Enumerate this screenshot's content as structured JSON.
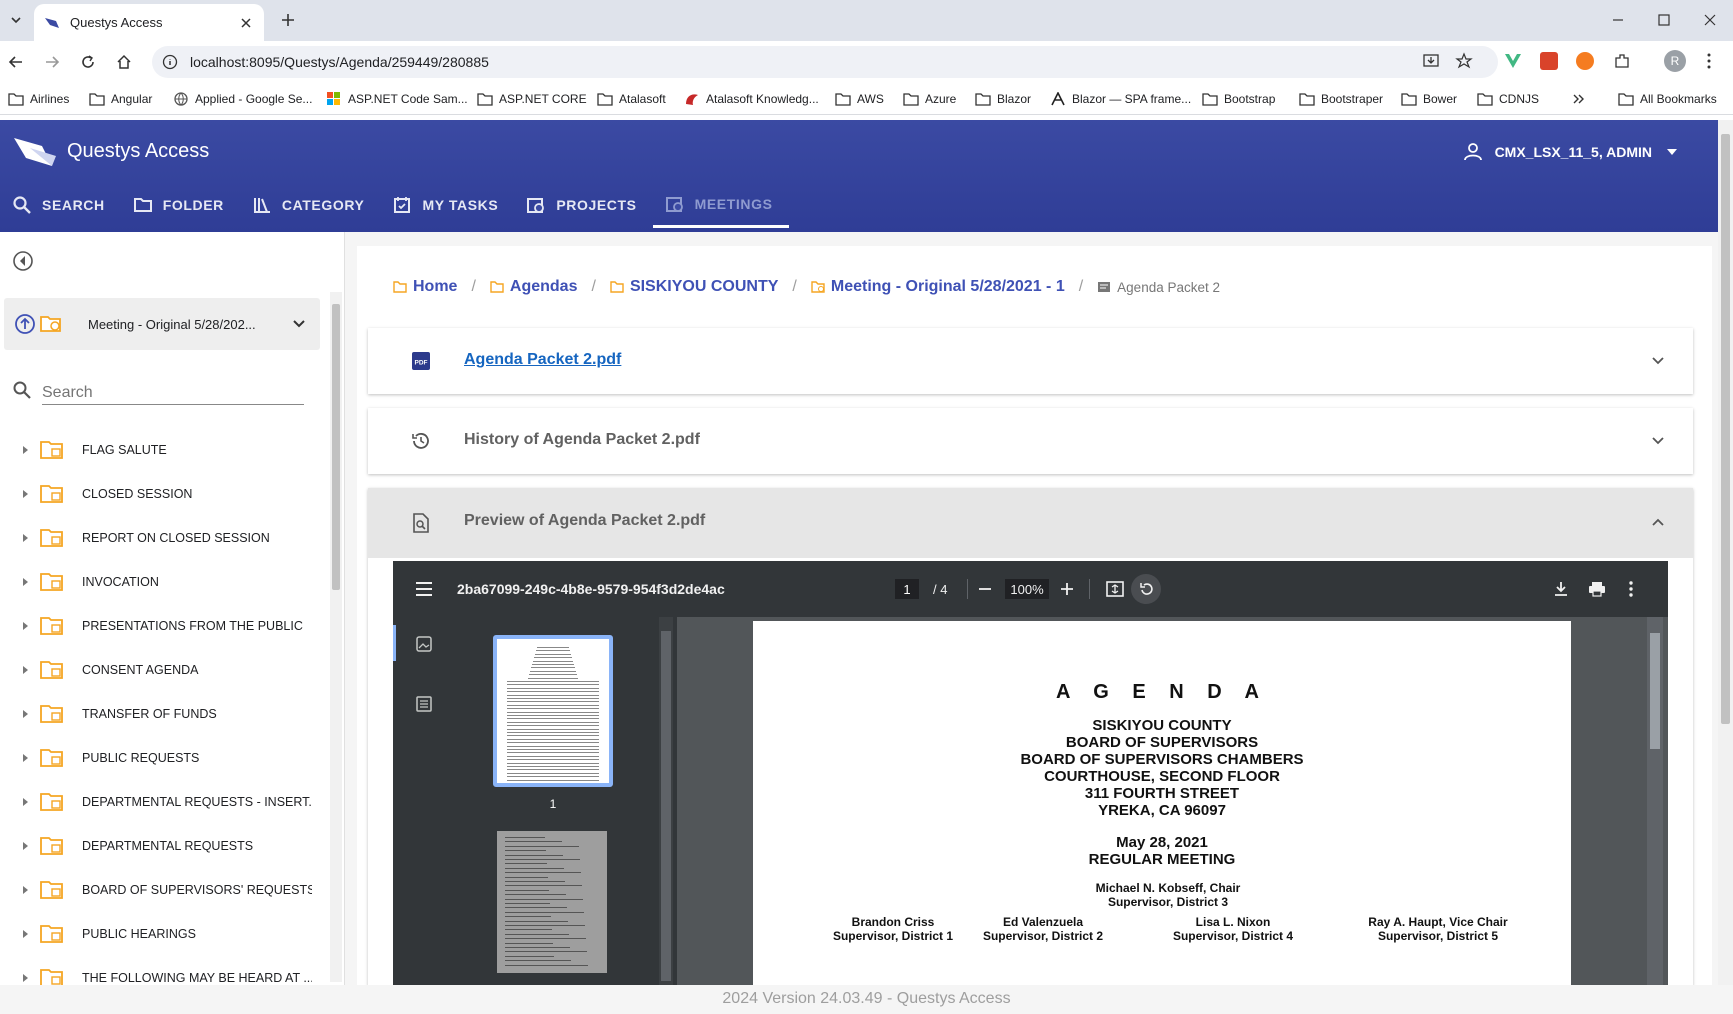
{
  "browser": {
    "tab_title": "Questys Access",
    "url": "localhost:8095/Questys/Agenda/259449/280885",
    "bookmarks": [
      "Airlines",
      "Angular",
      "Applied - Google Se...",
      "ASP.NET Code Sam...",
      "ASP.NET CORE",
      "Atalasoft",
      "Atalasoft Knowledg...",
      "AWS",
      "Azure",
      "Blazor",
      "Blazor — SPA frame...",
      "Bootstrap",
      "Bootstraper",
      "Bower",
      "CDNJS"
    ],
    "all_bookmarks": "All Bookmarks",
    "profile_initial": "R"
  },
  "app": {
    "title": "Questys Access",
    "user": "CMX_LSX_11_5, ADMIN",
    "nav": [
      "SEARCH",
      "FOLDER",
      "CATEGORY",
      "MY TASKS",
      "PROJECTS",
      "MEETINGS"
    ]
  },
  "sidebar": {
    "meeting": "Meeting - Original 5/28/202...",
    "search_placeholder": "Search",
    "items": [
      "FLAG SALUTE",
      "CLOSED SESSION",
      "REPORT ON CLOSED SESSION",
      "INVOCATION",
      "PRESENTATIONS FROM THE PUBLIC",
      "CONSENT AGENDA",
      "TRANSFER OF FUNDS",
      "PUBLIC REQUESTS",
      "DEPARTMENTAL REQUESTS - INSERT...",
      "DEPARTMENTAL REQUESTS",
      "BOARD OF SUPERVISORS' REQUESTS",
      "PUBLIC HEARINGS",
      "THE FOLLOWING MAY BE HEARD AT ..."
    ]
  },
  "breadcrumb": {
    "home": "Home",
    "agendas": "Agendas",
    "county": "SISKIYOU COUNTY",
    "meeting": "Meeting - Original 5/28/2021 - 1",
    "current": "Agenda Packet 2",
    "sep": "/"
  },
  "panels": {
    "file": "Agenda Packet 2.pdf",
    "history": "History of Agenda Packet 2.pdf",
    "preview": "Preview of Agenda Packet 2.pdf",
    "pdf_badge": "PDF"
  },
  "pdf": {
    "filename": "2ba67099-249c-4b8e-9579-954f3d2de4ac",
    "page": "1",
    "total": "/  4",
    "zoom": "100%",
    "thumb_label": "1",
    "page_content": {
      "heading": "A G E N D A",
      "lines": [
        "SISKIYOU COUNTY",
        "BOARD OF SUPERVISORS",
        "BOARD OF SUPERVISORS CHAMBERS",
        "COURTHOUSE, SECOND FLOOR",
        "311 FOURTH STREET",
        "YREKA, CA 96097"
      ],
      "date": "May 28, 2021",
      "meeting_type": "REGULAR MEETING",
      "chair": [
        "Michael N. Kobseff, Chair",
        "Supervisor, District 3"
      ],
      "members": [
        [
          "Brandon Criss",
          "Supervisor, District 1"
        ],
        [
          "Ed Valenzuela",
          "Supervisor, District 2"
        ],
        [
          "Lisa L. Nixon",
          "Supervisor, District 4"
        ],
        [
          "Ray A. Haupt, Vice Chair",
          "Supervisor, District 5"
        ]
      ]
    }
  },
  "footer": "2024 Version 24.03.49 - Questys Access",
  "colors": {
    "appbar": "#3b4aa3",
    "accent": "#3f51b5",
    "folder": "#f5a623"
  }
}
